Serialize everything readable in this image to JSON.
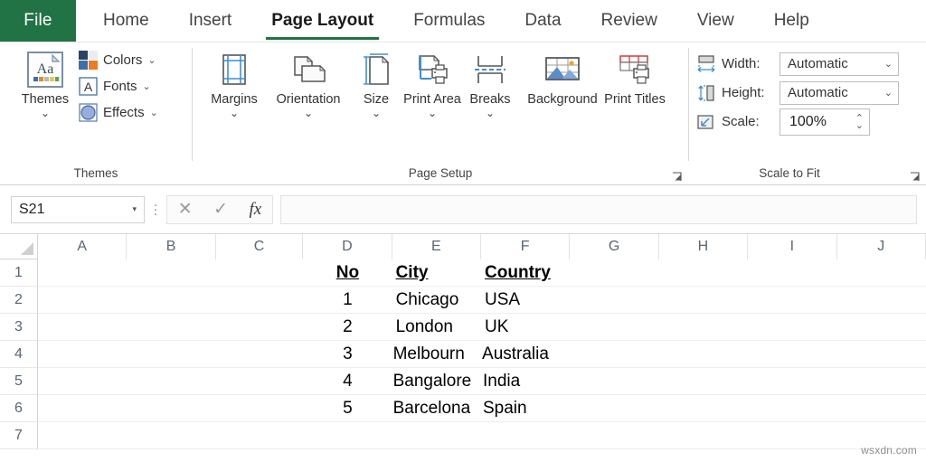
{
  "tabs": {
    "file": "File",
    "items": [
      "Home",
      "Insert",
      "Page Layout",
      "Formulas",
      "Data",
      "Review",
      "View",
      "Help"
    ],
    "active": "Page Layout"
  },
  "ribbon": {
    "themes_group": {
      "label": "Themes",
      "themes_button": "Themes",
      "caret": "⌄",
      "small_buttons": [
        {
          "label": "Colors",
          "caret": "⌄",
          "icon": "theme-colors-icon"
        },
        {
          "label": "Fonts",
          "caret": "⌄",
          "icon": "theme-fonts-icon"
        },
        {
          "label": "Effects",
          "caret": "⌄",
          "icon": "theme-effects-icon"
        }
      ]
    },
    "page_setup_group": {
      "label": "Page Setup",
      "buttons": [
        {
          "label": "Margins",
          "caret": "⌄",
          "icon": "margins-icon"
        },
        {
          "label": "Orientation",
          "caret": "⌄",
          "icon": "orientation-icon"
        },
        {
          "label": "Size",
          "caret": "⌄",
          "icon": "size-icon"
        },
        {
          "label": "Print Area",
          "caret": "⌄",
          "icon": "print-area-icon"
        },
        {
          "label": "Breaks",
          "caret": "⌄",
          "icon": "breaks-icon"
        },
        {
          "label": "Background",
          "caret": "",
          "icon": "background-icon"
        },
        {
          "label": "Print Titles",
          "caret": "",
          "icon": "print-titles-icon"
        }
      ],
      "dialog_launcher": "page-setup-dialog-launcher"
    },
    "scale_to_fit_group": {
      "label": "Scale to Fit",
      "width": {
        "label": "Width:",
        "value": "Automatic",
        "caret": "⌄",
        "icon": "fit-width-icon"
      },
      "height": {
        "label": "Height:",
        "value": "Automatic",
        "caret": "⌄",
        "icon": "fit-height-icon"
      },
      "scale": {
        "label": "Scale:",
        "value": "100%",
        "up": "⌃",
        "down": "⌄",
        "icon": "scale-icon"
      },
      "dialog_launcher": "scale-to-fit-dialog-launcher"
    }
  },
  "formula_bar": {
    "name_box_value": "S21",
    "name_box_caret": "▾",
    "cancel_icon": "✕",
    "enter_icon": "✓",
    "function_icon": "fx",
    "formula_value": "",
    "formula_placeholder": ""
  },
  "grid": {
    "columns": [
      "A",
      "B",
      "C",
      "D",
      "E",
      "F",
      "G",
      "H",
      "I",
      "J"
    ],
    "rows": [
      "1",
      "2",
      "3",
      "4",
      "5",
      "6",
      "7"
    ],
    "header_row": {
      "no": "No",
      "city": "City",
      "country": "Country"
    },
    "data": [
      {
        "no": "1",
        "city": "Chicago",
        "country": "USA"
      },
      {
        "no": "2",
        "city": "London",
        "country": "UK"
      },
      {
        "no": "3",
        "city": "Melbourn",
        "country": "Australia"
      },
      {
        "no": "4",
        "city": "Bangalore",
        "country": "India"
      },
      {
        "no": "5",
        "city": "Barcelona",
        "country": "Spain"
      }
    ]
  },
  "watermark": "wsxdn.com",
  "colors": {
    "excel_green": "#217346",
    "tab_text": "#444444",
    "grid_line": "#e3e3e3",
    "header_text": "#5a6672"
  }
}
